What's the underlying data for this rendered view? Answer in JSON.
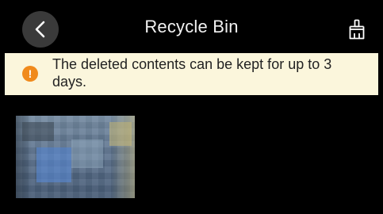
{
  "header": {
    "title": "Recycle Bin",
    "back_icon": "back-chevron-icon",
    "clean_icon": "broom-clean-icon"
  },
  "notice": {
    "icon": "warning-circle-icon",
    "icon_glyph": "!",
    "text": "The deleted contents can be kept for up to 3 days."
  },
  "colors": {
    "background": "#000000",
    "notice_background": "#fbf6dc",
    "warning": "#f08a1c",
    "back_button": "#3a3a3a"
  },
  "items": [
    {
      "type": "image",
      "content": "blurred photo thumbnail"
    }
  ]
}
